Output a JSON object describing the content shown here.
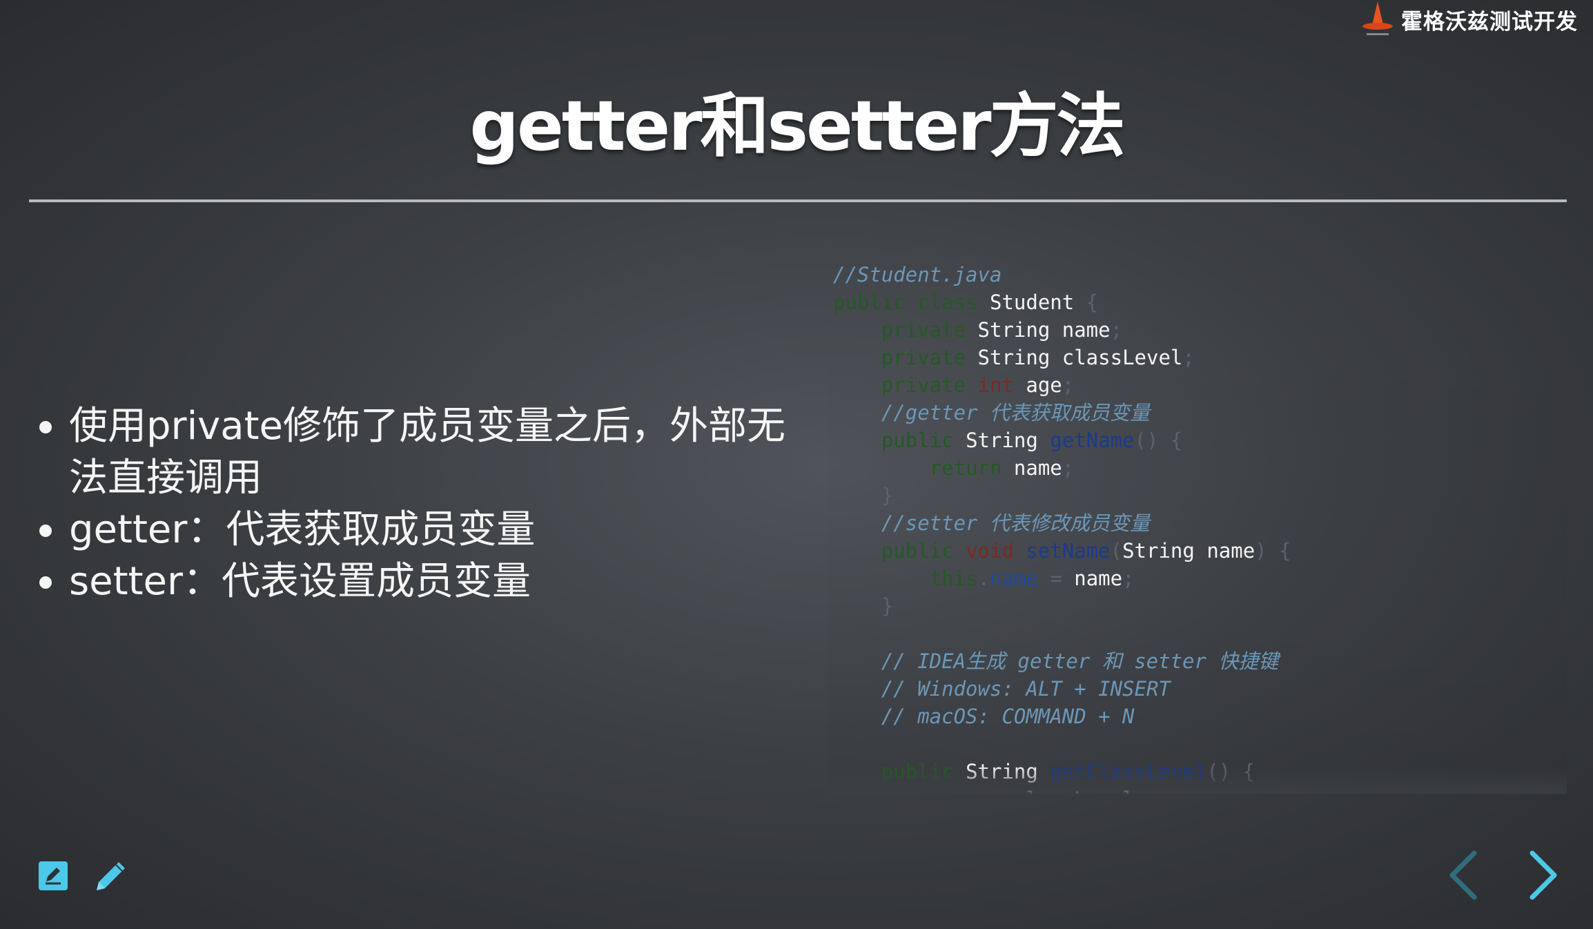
{
  "brand": {
    "name": "霍格沃兹测试开发",
    "logo_icon": "wizard-hat-icon"
  },
  "slide": {
    "title": "getter和setter方法",
    "bullets": [
      "使用private修饰了成员变量之后，外部无法直接调用",
      "getter：代表获取成员变量",
      "setter：代表设置成员变量"
    ],
    "code": {
      "line1": "//Student.java",
      "cls_kw": "public class",
      "cls_name": "Student",
      "private": "private",
      "string": "String",
      "int": "int",
      "name": "name",
      "class_level": "classLevel",
      "age": "age",
      "getter_comment": "//getter 代表获取成员变量",
      "public": "public",
      "get_name": "getName",
      "return": "return",
      "setter_comment": "//setter 代表修改成员变量",
      "void": "void",
      "set_name": "setName",
      "this": "this",
      "idea_comment": "// IDEA生成 getter 和 setter 快捷键",
      "windows_comment": "// Windows: ALT + INSERT",
      "mac_comment": "// macOS: COMMAND + N",
      "get_class_level": "getClassLevel"
    }
  },
  "toolbar": {
    "notes_icon": "edit-note-icon",
    "pen_icon": "pencil-icon"
  },
  "navigation": {
    "prev_icon": "chevron-left-icon",
    "next_icon": "chevron-right-icon"
  },
  "colors": {
    "accent": "#4cc8e8",
    "nav_disabled": "#2f6d7c",
    "comment": "#6b97b8",
    "keyword": "#235a23"
  }
}
